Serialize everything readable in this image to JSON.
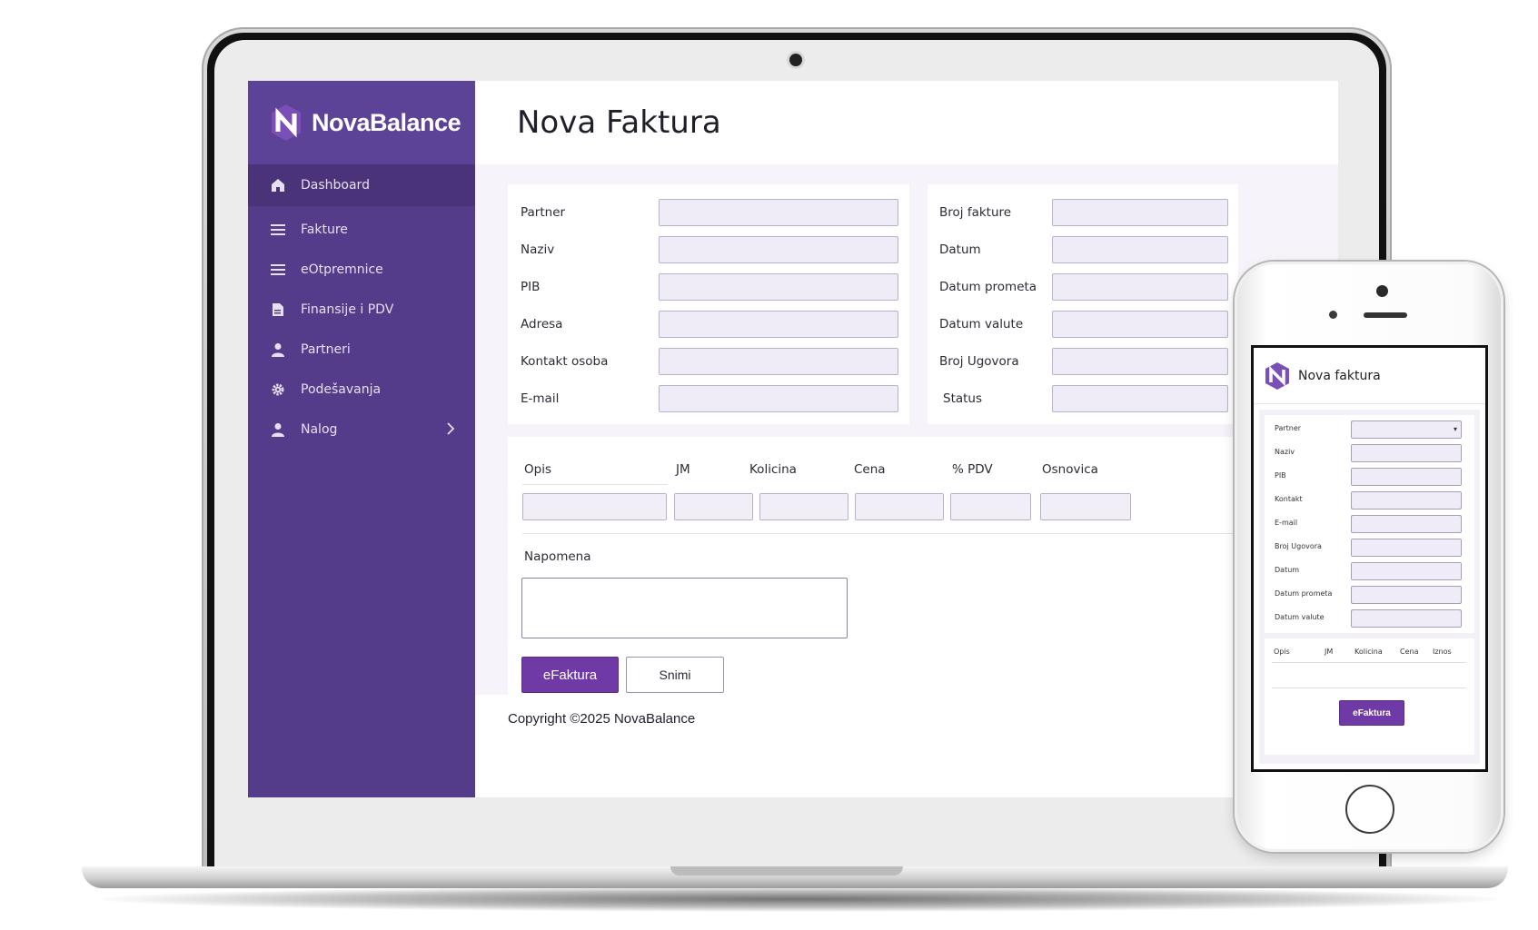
{
  "brand": {
    "name": "NovaBalance",
    "accent": "#553c8b",
    "primary_button": "#6f3aa6"
  },
  "sidebar": {
    "items": [
      {
        "label": "Dashboard",
        "icon": "home-icon"
      },
      {
        "label": "Fakture",
        "icon": "menu-lines-icon"
      },
      {
        "label": "eOtpremnice",
        "icon": "menu-lines-icon"
      },
      {
        "label": "Finansije i PDV",
        "icon": "document-icon"
      },
      {
        "label": "Partneri",
        "icon": "user-icon"
      },
      {
        "label": "Podešavanja",
        "icon": "gear-icon"
      },
      {
        "label": "Nalog",
        "icon": "user-icon"
      }
    ]
  },
  "page": {
    "title": "Nova Faktura"
  },
  "form_left": {
    "fields": [
      {
        "label": "Partner",
        "value": ""
      },
      {
        "label": "Naziv",
        "value": ""
      },
      {
        "label": "PIB",
        "value": ""
      },
      {
        "label": "Adresa",
        "value": ""
      },
      {
        "label": "Kontakt osoba",
        "value": ""
      },
      {
        "label": "E-mail",
        "value": ""
      }
    ]
  },
  "form_right": {
    "fields": [
      {
        "label": "Broj fakture",
        "value": ""
      },
      {
        "label": "Datum",
        "value": ""
      },
      {
        "label": "Datum prometa",
        "value": ""
      },
      {
        "label": "Datum valute",
        "value": ""
      },
      {
        "label": "Broj Ugovora",
        "value": ""
      },
      {
        "label": "Status",
        "value": ""
      }
    ]
  },
  "items_table": {
    "columns": [
      "Opis",
      "JM",
      "Kolicina",
      "Cena",
      "% PDV",
      "Osnovica"
    ]
  },
  "notes": {
    "label": "Napomena",
    "value": ""
  },
  "actions": {
    "efaktura": "eFaktura",
    "save": "Snimi"
  },
  "footer": {
    "copyright": "Copyright ©2025 NovaBalance"
  },
  "mobile": {
    "title": "Nova faktura",
    "fields": [
      "Partner",
      "Naziv",
      "PIB",
      "Kontakt",
      "E-mail",
      "Broj Ugovora",
      "Datum",
      "Datum prometa",
      "Datum valute"
    ],
    "columns": [
      "Opis",
      "JM",
      "Kolicina",
      "Cena",
      "Iznos"
    ],
    "button": "eFaktura"
  }
}
